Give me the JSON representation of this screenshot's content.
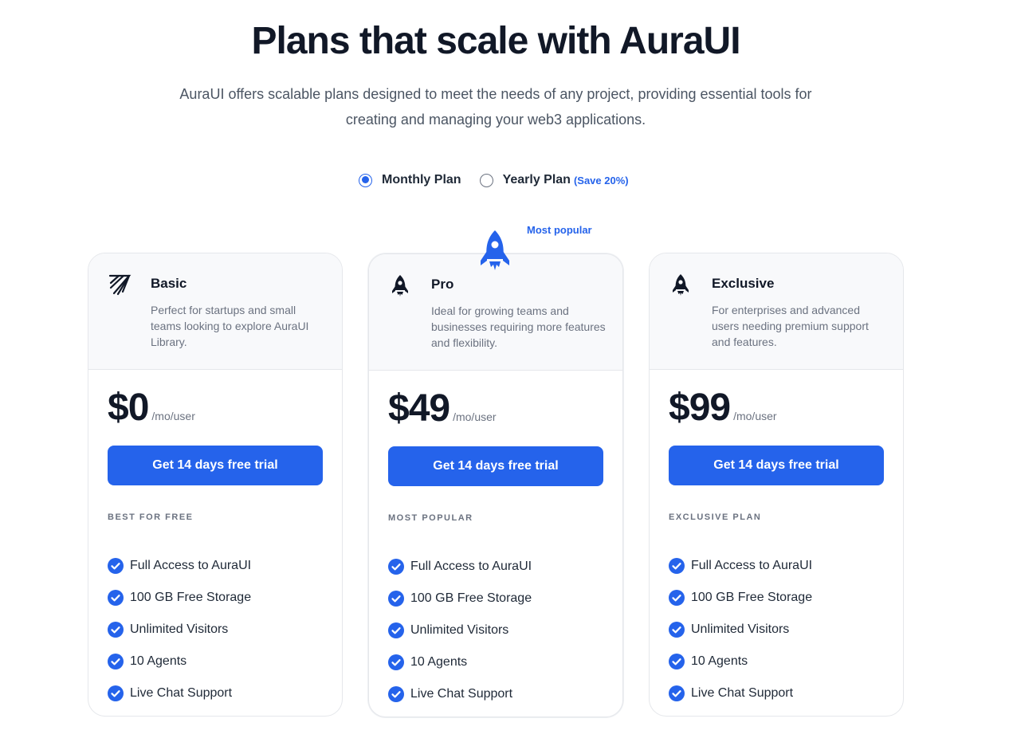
{
  "header": {
    "title": "Plans that scale with AuraUI",
    "subtitle": "AuraUI offers scalable plans designed to meet the needs of any project, providing essential tools for creating and managing your web3 applications."
  },
  "billing_toggle": {
    "monthly_label": "Monthly Plan",
    "yearly_label": "Yearly Plan",
    "yearly_badge": "(Save 20%)",
    "selected": "monthly"
  },
  "popular_tag": "Most popular",
  "accent_color": "#2563eb",
  "plans": [
    {
      "name": "Basic",
      "icon": "paper-plane-icon",
      "description": "Perfect for startups and small teams looking to explore AuraUI Library.",
      "price": "$0",
      "per": "/mo/user",
      "cta": "Get 14 days free trial",
      "tier_label": "BEST FOR FREE",
      "features": [
        "Full Access to AuraUI",
        "100 GB Free Storage",
        "Unlimited Visitors",
        "10 Agents",
        "Live Chat Support"
      ]
    },
    {
      "name": "Pro",
      "icon": "rocket-icon",
      "description": "Ideal for growing teams and businesses requiring more features and flexibility.",
      "price": "$49",
      "per": "/mo/user",
      "cta": "Get 14 days free trial",
      "tier_label": "MOST POPULAR",
      "features": [
        "Full Access to AuraUI",
        "100 GB Free Storage",
        "Unlimited Visitors",
        "10 Agents",
        "Live Chat Support"
      ]
    },
    {
      "name": "Exclusive",
      "icon": "rocket-icon",
      "description": "For enterprises and advanced users needing premium support and features.",
      "price": "$99",
      "per": "/mo/user",
      "cta": "Get 14 days free trial",
      "tier_label": "EXCLUSIVE PLAN",
      "features": [
        "Full Access to AuraUI",
        "100 GB Free Storage",
        "Unlimited Visitors",
        "10 Agents",
        "Live Chat Support"
      ]
    }
  ]
}
